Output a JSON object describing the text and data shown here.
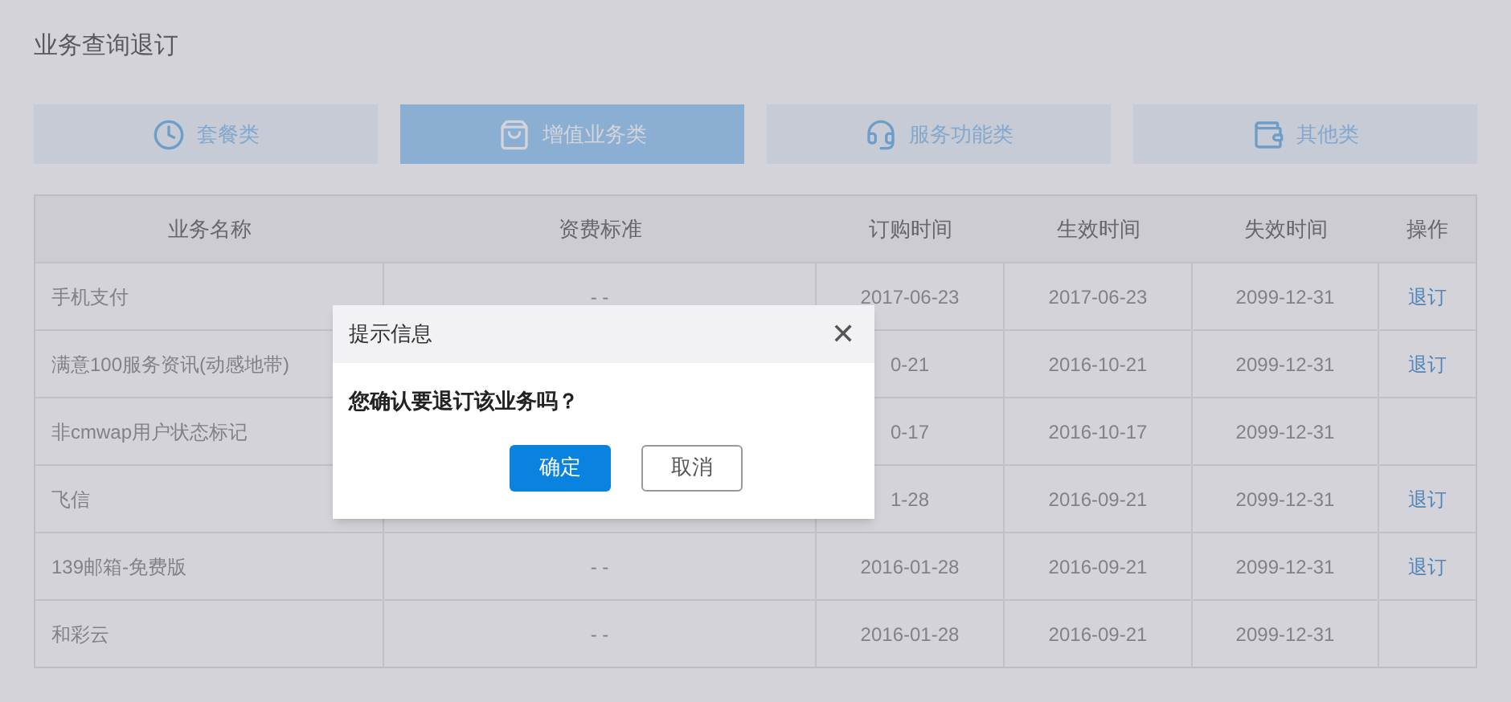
{
  "page_title": "业务查询退订",
  "tabs": [
    {
      "label": "套餐类",
      "selected": false,
      "kind": "clock"
    },
    {
      "label": "增值业务类",
      "selected": true,
      "kind": "bag"
    },
    {
      "label": "服务功能类",
      "selected": false,
      "kind": "headset"
    },
    {
      "label": "其他类",
      "selected": false,
      "kind": "wallet"
    }
  ],
  "table": {
    "columns": [
      "业务名称",
      "资费标准",
      "订购时间",
      "生效时间",
      "失效时间",
      "操作"
    ],
    "rows": [
      {
        "name": "手机支付",
        "fee": "- -",
        "ordered": "2017-06-23",
        "effective": "2017-06-23",
        "expires": "2099-12-31",
        "action": "退订"
      },
      {
        "name": "满意100服务资讯(动感地带)",
        "ordered": "0-21",
        "effective": "2016-10-21",
        "expires": "2099-12-31",
        "action": "退订"
      },
      {
        "name": "非cmwap用户状态标记",
        "ordered": "0-17",
        "effective": "2016-10-17",
        "expires": "2099-12-31"
      },
      {
        "name": "飞信",
        "ordered": "1-28",
        "effective": "2016-09-21",
        "expires": "2099-12-31",
        "action": "退订"
      },
      {
        "name": "139邮箱-免费版",
        "fee": "- -",
        "ordered": "2016-01-28",
        "effective": "2016-09-21",
        "expires": "2099-12-31",
        "action": "退订"
      },
      {
        "name": "和彩云",
        "fee": "- -",
        "ordered": "2016-01-28",
        "effective": "2016-09-21",
        "expires": "2099-12-31"
      }
    ]
  },
  "dialog": {
    "title": "提示信息",
    "close": "✕",
    "message": "您确认要退订该业务吗？",
    "buttons": [
      {
        "label": "确定",
        "kind": "primary"
      },
      {
        "label": "取消",
        "kind": "secondary"
      }
    ]
  }
}
